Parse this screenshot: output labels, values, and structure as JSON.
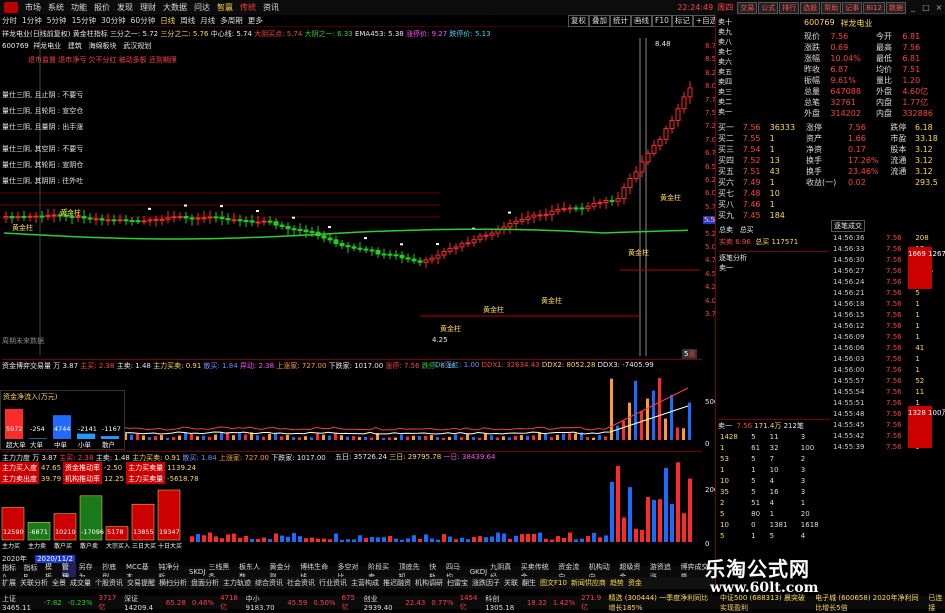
{
  "menubar": {
    "items": [
      "市场",
      "系统",
      "功能",
      "报价",
      "发现",
      "理财",
      "大数据",
      "问达"
    ],
    "sel_zhixuan": "智赢",
    "brand": "传统",
    "zixun": "资讯",
    "clock": "22:24:49",
    "weekday": "周四",
    "tool_buttons": [
      "交易",
      "公式",
      "排行",
      "选股",
      "帮助",
      "记事",
      "BI12",
      "数据"
    ]
  },
  "periodbar": {
    "items": [
      "分时",
      "1分钟",
      "5分钟",
      "15分钟",
      "30分钟",
      "60分钟",
      "日线",
      "周线",
      "月线",
      "多周期",
      "更多"
    ],
    "selected": "日线",
    "right_tabs": [
      "复权",
      "叠加",
      "统计",
      "画线",
      "F10",
      "标记",
      "+自选",
      "返回"
    ]
  },
  "stock": {
    "code": "600769",
    "name": "祥龙电业",
    "full": "祥龙电业(日线前复权)",
    "c1": "建筑",
    "c2": "海绵板块",
    "c3": "武汉规划"
  },
  "main_indicator": {
    "label": "黄金柱指标",
    "v1": "三分之一: 5.72",
    "v2": "三分之二: 5.76",
    "v3": "大阴买点: 5.74",
    "v4": "中心线: 5.74",
    "v5": "大阴之一: 6.33",
    "v6": "EMA453: 5.38",
    "v7": "涨停价: 9.27",
    "v8": "跌停价: 5.13",
    "notes": "退市监督 退市净亏 欠不分红 被动多板 还到期限",
    "lines": [
      "量仕三阴, 且止阴 : 不要亏",
      "量仕三阴, 且轮阳 : 宣空仓",
      "量仕三阴, 且量阴 : 出手涨",
      "量仕三阴, 其空阴 : 不要亏",
      "量仕三阴, 其轮阳 : 宣阴仓",
      "量仕三阴, 其阴阴 : 往外吐"
    ],
    "nodata": "周期未来数据"
  },
  "labels": {
    "gold1": "黄金柱",
    "gold2": "黄金柱",
    "gold3": "黄金柱",
    "gold4": "黄金柱",
    "gold5": "黄金柱",
    "gold6": "黄金柱",
    "gold7": "黄金柱",
    "high": "8.48",
    "low": "4.25",
    "right_tag": "5.51",
    "top_tag1": "5",
    "top_tag2": "涨"
  },
  "price_axis": [
    "8.75",
    "8.50",
    "8.25",
    "8.00",
    "7.75",
    "7.50",
    "7.25",
    "7.00",
    "6.75",
    "6.50",
    "6.25",
    "6.00",
    "5.75",
    "5.50",
    "5.25",
    "5.00",
    "4.75",
    "4.50",
    "4.25",
    "4.00",
    "3.75"
  ],
  "fund_panel": {
    "header": "资金博弈交易量",
    "unit": "万",
    "predict": "3.87",
    "zhuli": "主买: 2.38",
    "zhujin": "主卖: 1.48",
    "jinmai": "主力买卖: 0.91",
    "j2": "散买: 1.84",
    "j3": "异动: 2.38",
    "j4": "上涨家: 727.00",
    "j5": "下跌家: 1017.00",
    "j6": "涨停: 7.56",
    "j7": "跌停: 6.18",
    "j8": "DX强红: 1.00",
    "j9": "DDX1: 32634.43",
    "j10": "DDX2: 8052.28",
    "j11": "DDX3: -7405.99",
    "box_title": "资金净流入(万元)",
    "boxes": [
      "5972",
      "-254",
      "4744",
      "-2141",
      "-1167"
    ],
    "box_labels": [
      "超大单",
      "大单",
      "中单",
      "小单",
      "散户"
    ],
    "axis": [
      "50000",
      "0"
    ]
  },
  "mainforce_panel": {
    "header": "主力力度",
    "unit": "万",
    "predict": "3.87",
    "m1": "主买: 2.38",
    "m2": "主卖: 1.48",
    "m3": "主力买卖: 0.91",
    "m4": "散买: 1.84",
    "m5": "上涨家: 727.00",
    "m6": "下跌家: 1017.00",
    "m7": "五日: 35726.24",
    "m8": "三日: 29795.78",
    "m9": "一日: 38439.64",
    "rows": [
      [
        "主力买入度",
        "47.65",
        "资金推动率",
        "-2.50",
        "主力买卖量",
        "1139.24"
      ],
      [
        "主力卖出度",
        "39.79",
        "机构推动率",
        "12.25",
        "主力买卖量",
        "-5618.78"
      ]
    ],
    "bars": [
      "12590",
      "-6871",
      "10210",
      "-17096",
      "5178",
      "13855",
      "19347"
    ],
    "bar_labels": [
      "主力买",
      "主力卖",
      "散户买",
      "散户卖",
      "大宗买入",
      "三日大买",
      "十日大买"
    ],
    "axis": [
      "200000",
      "0"
    ]
  },
  "right_panel": {
    "header": "卖十",
    "code": "600769",
    "name": "祥龙电业",
    "sell": [
      [
        "卖十",
        ""
      ],
      [
        "卖九",
        ""
      ],
      [
        "卖八",
        ""
      ],
      [
        "卖七",
        ""
      ],
      [
        "卖六",
        ""
      ],
      [
        "卖五",
        ""
      ],
      [
        "卖四",
        ""
      ],
      [
        "卖三",
        ""
      ],
      [
        "卖二",
        ""
      ],
      [
        "卖一",
        ""
      ]
    ],
    "buy": [
      [
        "买一",
        "7.56",
        "36333"
      ],
      [
        "买二",
        "7.55",
        "1"
      ],
      [
        "买三",
        "7.54",
        "1"
      ],
      [
        "买四",
        "7.52",
        "13"
      ],
      [
        "买五",
        "7.51",
        "43"
      ],
      [
        "买六",
        "7.49",
        "1"
      ],
      [
        "买七",
        "7.48",
        "10"
      ],
      [
        "买八",
        "7.46",
        "1"
      ],
      [
        "买九",
        "7.45",
        "184"
      ]
    ],
    "quote": [
      [
        "现价",
        "7.56",
        "今开",
        "6.81"
      ],
      [
        "涨跌",
        "0.69",
        "最高",
        "7.56"
      ],
      [
        "涨幅",
        "10.04%",
        "最低",
        "6.81"
      ],
      [
        "昨收",
        "6.87",
        "均价",
        "7.51"
      ],
      [
        "振幅",
        "9.61%",
        "量比",
        "1.20"
      ],
      [
        "总量",
        "647088",
        "外盘",
        "4.60亿"
      ],
      [
        "总笔",
        "32761",
        "内盘",
        "1.77亿"
      ],
      [
        "外盘",
        "314202",
        "内盘",
        "332886"
      ]
    ],
    "sumbuy": "总卖",
    "sumsell": "总买",
    "weimai": "实卖 6.96",
    "weibuy": "总买 117571",
    "fin": [
      [
        "涨停",
        "7.56",
        "跌停",
        "6.18"
      ],
      [
        "资产",
        "1.66",
        "市盈",
        "33.18"
      ],
      [
        "净资",
        "0.17",
        "股本",
        "3.12"
      ],
      [
        "换手",
        "17.26%",
        "流通",
        "3.12"
      ],
      [
        "换手",
        "23.46%",
        "流通",
        "3.12"
      ],
      [
        "收益(一)",
        "0.02",
        "",
        "293.5"
      ]
    ],
    "trade_title": "逐笔成交",
    "trades": [
      [
        "14:56:36",
        "7.56",
        "208"
      ],
      [
        "14:56:33",
        "7.56",
        "17"
      ],
      [
        "14:56:30",
        "7.56",
        "5"
      ],
      [
        "14:56:27",
        "7.56",
        "2005"
      ],
      [
        "14:56:24",
        "7.56",
        "41"
      ],
      [
        "14:56:21",
        "7.56",
        "5"
      ],
      [
        "14:56:18",
        "7.56",
        "1"
      ],
      [
        "14:56:15",
        "7.56",
        "1"
      ],
      [
        "14:56:12",
        "7.56",
        "1"
      ],
      [
        "14:56:09",
        "7.56",
        "1"
      ],
      [
        "14:56:06",
        "7.56",
        "41"
      ],
      [
        "14:56:03",
        "7.56",
        "1"
      ],
      [
        "14:56:00",
        "7.56",
        "1"
      ],
      [
        "14:55:57",
        "7.56",
        "52"
      ],
      [
        "14:55:54",
        "7.56",
        "11"
      ],
      [
        "14:55:51",
        "7.56",
        "1"
      ],
      [
        "14:55:48",
        "7.56",
        "1"
      ],
      [
        "14:55:45",
        "7.56",
        "8"
      ],
      [
        "14:55:42",
        "7.56",
        "18"
      ],
      [
        "14:55:39",
        "7.56",
        "5"
      ]
    ],
    "red_flag1": "1669 1267万",
    "red_flag2": "1328 100万",
    "depth_title": "卖一",
    "depth_header": [
      "7.56",
      "171.4万",
      "212笔"
    ],
    "depth": [
      [
        "1428",
        "5",
        "11",
        "3"
      ],
      [
        "1",
        "61",
        "32",
        "100"
      ],
      [
        "53",
        "5",
        "7",
        "2"
      ],
      [
        "1",
        "1",
        "10",
        "3"
      ],
      [
        "10",
        "5",
        "4",
        "3"
      ],
      [
        "35",
        "5",
        "16",
        "3"
      ],
      [
        "2",
        "51",
        "4",
        "1"
      ],
      [
        "5",
        "80",
        "1",
        "20"
      ],
      [
        "10",
        "0",
        "1381",
        "1618"
      ],
      [
        "5",
        "1",
        "5",
        "4"
      ]
    ],
    "fold_tag": "逐笔分析",
    "fold_tag2": "卖一"
  },
  "bottom": {
    "tabs1": [
      "指标A",
      "指标B",
      "模板",
      "管理",
      "另存为",
      "抄底型",
      "MCC基本",
      "钝净分析",
      "SKDJ",
      "三线黑条",
      "板东人数",
      "黄金分割",
      "博纬生命线",
      "多空对比",
      "阶段买卖",
      "顶底先知",
      "快轨",
      "四马均",
      "GKDJ",
      "九阴真经",
      "买卖传统金",
      "资金流向",
      "机构动向",
      "超级资金",
      "游资追涨",
      "博弈成交量"
    ],
    "tabs2": [
      "扩展",
      "关联分析",
      "全景",
      "成交量",
      "个股资讯",
      "交易提醒",
      "横扫分析",
      "盘面分析",
      "主力轨迹",
      "综合资讯",
      "社会资讯",
      "行业资讯",
      "主营构成",
      "推迟融资",
      "机构调研",
      "扫雷宝",
      "涨跌因子",
      "关联",
      "翻生"
    ],
    "tool_left": "图文F10",
    "tool_mid": "新闻供应商",
    "tool_right": "趋势",
    "tool_right2": "资金",
    "year_label": "2020年",
    "year_label2": "2020/11/2",
    "status": [
      "上证 3465.11",
      "-7.82",
      "-0.23%",
      "3717亿",
      "深证 14209.4",
      "65.28",
      "0.46%",
      "4718亿",
      "中小 9183.70",
      "45.59",
      "0.50%",
      "675亿",
      "创业 2939.40",
      "22.43",
      "0.77%",
      "1454亿",
      "科创 1305.18",
      "18.32",
      "1.42%",
      "271.9亿"
    ],
    "ticker": "精选 (300444) 一季度净利同比增长185%",
    "news1": "中证500 (688313) 晨突破实现盈利",
    "news2": "电子城 (600658) 2020年净利同比增长5倍",
    "news3": "已连接"
  },
  "watermark": {
    "cn": "乐淘公式网",
    "url": "www.60lt.com"
  }
}
